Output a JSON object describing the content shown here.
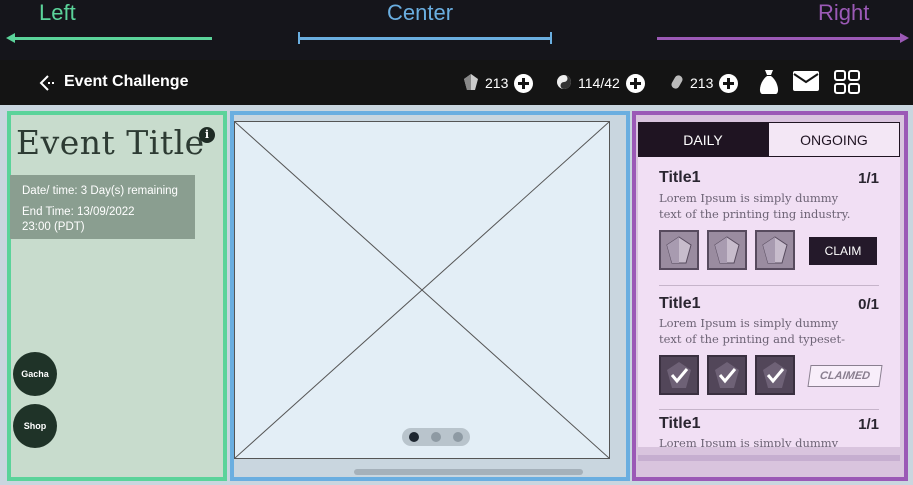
{
  "guide": {
    "left_label": "Left",
    "center_label": "Center",
    "right_label": "Right",
    "left_color": "#5bd39a",
    "center_color": "#6aaee0",
    "right_color": "#9b59b6"
  },
  "topbar": {
    "back_icon": "back-arrow-icon",
    "title": "Event Challenge",
    "currencies": [
      {
        "icon": "crystal-icon",
        "value": "213"
      },
      {
        "icon": "yin-yang-icon",
        "value": "114/42"
      },
      {
        "icon": "capsule-icon",
        "value": "213"
      }
    ],
    "icons": [
      "bag-icon",
      "mail-icon",
      "grid-menu-icon"
    ]
  },
  "left_panel": {
    "event_title": "Event Title",
    "info_icon": "i",
    "date_line": "Date/ time: 3 Day(s) remaining",
    "end_time_line1": "End Time: 13/09/2022",
    "end_time_line2": "23:00 (PDT)",
    "gacha_label": "Gacha",
    "shop_label": "Shop"
  },
  "center_panel": {
    "carousel_pages": 3,
    "active_page": 1
  },
  "right_panel": {
    "tabs": [
      {
        "label": "DAILY",
        "active": true
      },
      {
        "label": "ONGOING",
        "active": false
      }
    ],
    "quests": [
      {
        "title": "Title1",
        "count": "1/1",
        "desc_line1": "Lorem Ipsum is simply dummy",
        "desc_line2": "text of the printing ting industry.",
        "status": "claim",
        "action_label": "CLAIM"
      },
      {
        "title": "Title1",
        "count": "0/1",
        "desc_line1": "Lorem Ipsum is simply dummy",
        "desc_line2": "text of the printing and typeset-",
        "status": "claimed",
        "action_label": "CLAIMED"
      },
      {
        "title": "Title1",
        "count": "1/1",
        "desc_line1": "Lorem Ipsum is simply dummy"
      }
    ]
  }
}
